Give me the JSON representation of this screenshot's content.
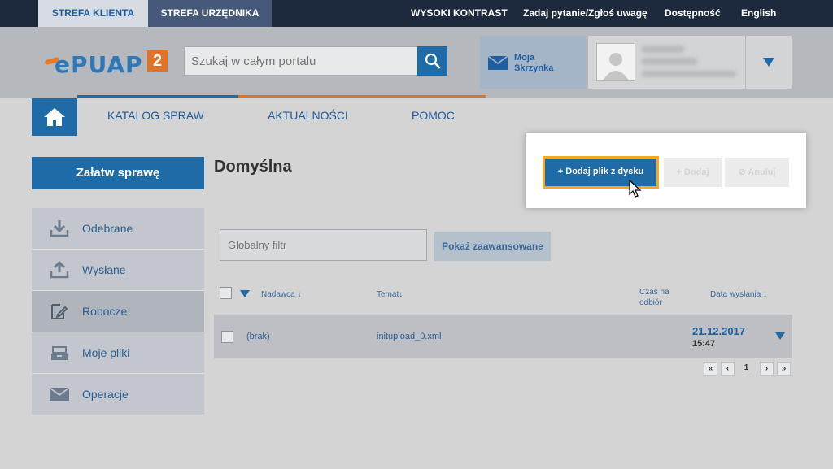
{
  "topbar": {
    "zone_client": "STREFA KLIENTA",
    "zone_official": "STREFA URZĘDNIKA",
    "high_contrast": "WYSOKI KONTRAST",
    "ask": "Zadaj pytanie/Zgłoś uwagę",
    "accessibility": "Dostępność",
    "language": "English"
  },
  "header": {
    "logo_text": "ePUAP",
    "logo_version": "2",
    "search_placeholder": "Szukaj w całym portalu",
    "mailbox_label": "Moja Skrzynka"
  },
  "nav": {
    "items": [
      "KATALOG SPRAW",
      "AKTUALNOŚCI",
      "POMOC"
    ]
  },
  "sidebar": {
    "solve_button": "Załatw sprawę",
    "items": [
      {
        "label": "Odebrane",
        "icon": "inbox-download-icon"
      },
      {
        "label": "Wysłane",
        "icon": "outbox-upload-icon"
      },
      {
        "label": "Robocze",
        "icon": "draft-edit-icon"
      },
      {
        "label": "Moje pliki",
        "icon": "files-tray-icon"
      },
      {
        "label": "Operacje",
        "icon": "envelope-icon"
      }
    ],
    "active_index": 2
  },
  "main": {
    "title": "Domyślna",
    "filter_placeholder": "Globalny filtr",
    "advanced_button": "Pokaż zaawansowane",
    "columns": {
      "sender": "Nadawca",
      "subject": "Temat",
      "pickup_time_1": "Czas na",
      "pickup_time_2": "odbiór",
      "sent_date": "Data wysłania"
    },
    "rows": [
      {
        "sender": "(brak)",
        "subject": "initupload_0.xml",
        "date": "21.12.2017",
        "time": "15:47"
      }
    ],
    "pager": {
      "first": "«",
      "prev": "‹",
      "page": "1",
      "next": "›",
      "last": "»"
    }
  },
  "popup": {
    "add_file_button": "+  Dodaj plik z dysku",
    "add_button": "Dodaj",
    "cancel_button": "Anuluj"
  },
  "colors": {
    "primary": "#1f6ba7",
    "accent_orange": "#e0732a",
    "highlight": "#f2a820",
    "topbar": "#1d2a3d"
  }
}
